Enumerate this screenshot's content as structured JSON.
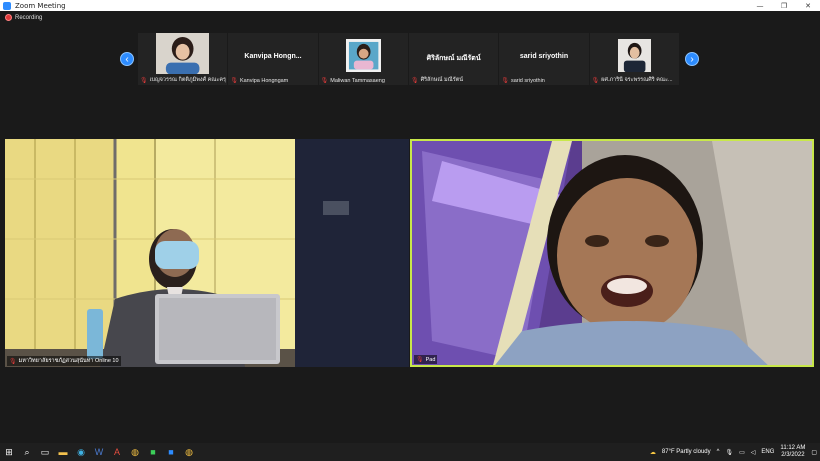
{
  "window": {
    "title": "Zoom Meeting"
  },
  "recording": {
    "label": "Recording"
  },
  "strip": {
    "participants": [
      {
        "name_small": "เบญจวรรณ กิตติภูมิพงศ์ คณะครุศาส...",
        "name_big": "",
        "has_video": true
      },
      {
        "name_small": "Kanvipa Hongngam",
        "name_big": "Kanvipa Hongn...",
        "has_video": false
      },
      {
        "name_small": "Maliwan Tammasaeng",
        "name_big": "",
        "has_video": true
      },
      {
        "name_small": "ศิริลักษณ์ มณีรัตน์",
        "name_big": "ศิริลักษณ์ มณีรัตน์",
        "has_video": false
      },
      {
        "name_small": "sarid sriyothin",
        "name_big": "sarid sriyothin",
        "has_video": false
      },
      {
        "name_small": "ผศ.ภารินี จระพรรณศิริ คณะ...",
        "name_big": "",
        "has_video": true
      }
    ]
  },
  "videos": {
    "left": {
      "label": "มหาวิทยาลัยราชภัฏสวนสุนันทา Online 10"
    },
    "right": {
      "label": "Pad"
    }
  },
  "taskbar": {
    "weather": "87°F  Partly cloudy",
    "lang": "ENG",
    "time": "11:12 AM",
    "date": "2/3/2022"
  },
  "colors": {
    "accent": "#2d8cff",
    "active_speaker": "#c8e84a",
    "record": "#e03a3a"
  }
}
